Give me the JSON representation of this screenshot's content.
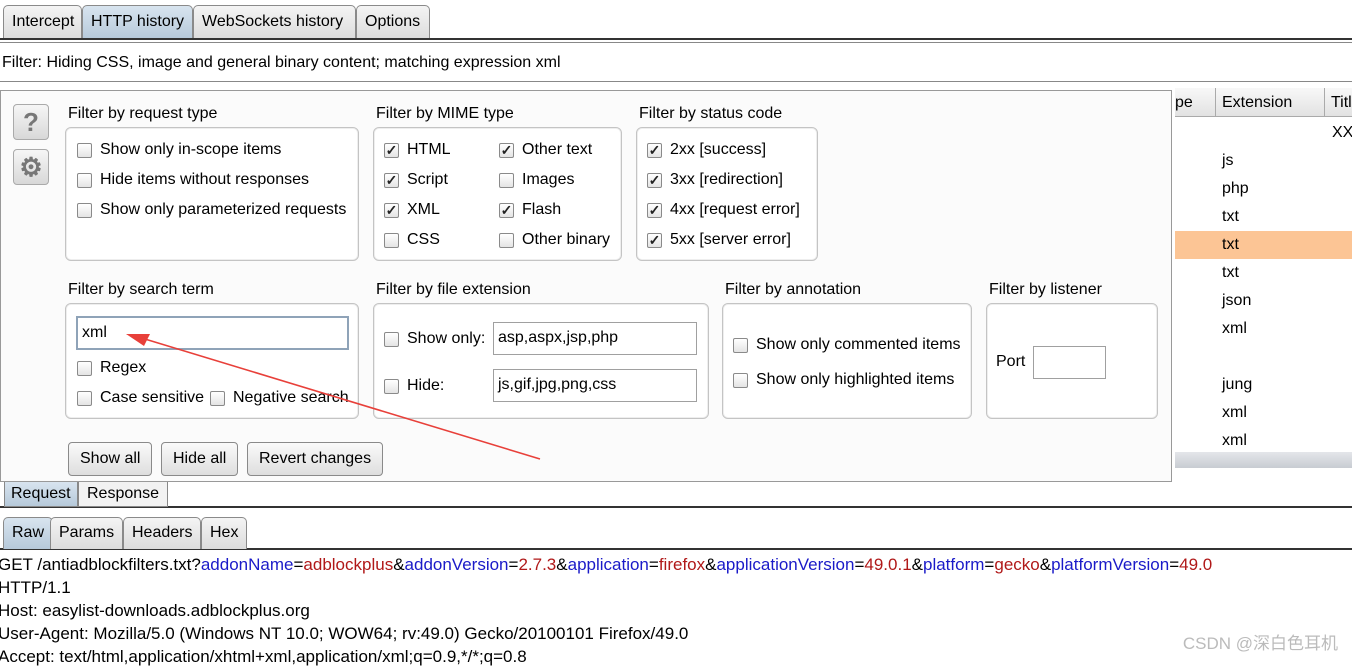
{
  "tabs": [
    {
      "label": "Intercept"
    },
    {
      "label": "HTTP history",
      "selected": true
    },
    {
      "label": "WebSockets history"
    },
    {
      "label": "Options"
    }
  ],
  "filter_bar": "Filter: Hiding CSS, image and general binary content;  matching expression xml",
  "table": {
    "headers": [
      "pe",
      "Extension",
      "Titl"
    ],
    "rows": [
      {
        "ext": "",
        "title": "XX"
      },
      {
        "ext": "js"
      },
      {
        "ext": "php"
      },
      {
        "ext": "txt"
      },
      {
        "ext": "txt",
        "highlighted": true
      },
      {
        "ext": "txt"
      },
      {
        "ext": "json"
      },
      {
        "ext": "xml"
      },
      {
        "ext": ""
      },
      {
        "ext": "jung"
      },
      {
        "ext": "xml"
      },
      {
        "ext": "xml"
      }
    ],
    "highlight_color": "#fcc595"
  },
  "filter": {
    "help_icon": "question-icon",
    "settings_icon": "gear-icon",
    "request_type": {
      "title": "Filter by request type",
      "items": [
        {
          "label": "Show only in-scope items",
          "checked": false
        },
        {
          "label": "Hide items without responses",
          "checked": false
        },
        {
          "label": "Show only parameterized requests",
          "checked": false
        }
      ]
    },
    "mime": {
      "title": "Filter by MIME type",
      "items": [
        {
          "label": "HTML",
          "checked": true
        },
        {
          "label": "Other text",
          "checked": true
        },
        {
          "label": "Script",
          "checked": true
        },
        {
          "label": "Images",
          "checked": false
        },
        {
          "label": "XML",
          "checked": true
        },
        {
          "label": "Flash",
          "checked": true
        },
        {
          "label": "CSS",
          "checked": false
        },
        {
          "label": "Other binary",
          "checked": false
        }
      ]
    },
    "status": {
      "title": "Filter by status code",
      "items": [
        {
          "label": "2xx  [success]",
          "checked": true
        },
        {
          "label": "3xx  [redirection]",
          "checked": true
        },
        {
          "label": "4xx  [request error]",
          "checked": true
        },
        {
          "label": "5xx  [server error]",
          "checked": true
        }
      ]
    },
    "search": {
      "title": "Filter by search term",
      "value": "xml",
      "regex": "Regex",
      "case": "Case sensitive",
      "negative": "Negative search"
    },
    "extension": {
      "title": "Filter by file extension",
      "show_only_label": "Show only:",
      "show_only_value": "asp,aspx,jsp,php",
      "hide_label": "Hide:",
      "hide_value": "js,gif,jpg,png,css"
    },
    "annotation": {
      "title": "Filter by annotation",
      "commented": "Show only commented items",
      "highlighted": "Show only highlighted items"
    },
    "listener": {
      "title": "Filter by listener",
      "port_label": "Port",
      "port_value": ""
    },
    "buttons": {
      "show_all": "Show all",
      "hide_all": "Hide all",
      "revert": "Revert changes"
    }
  },
  "message_tabs": [
    {
      "label": "Request",
      "selected": true
    },
    {
      "label": "Response"
    }
  ],
  "view_tabs": [
    {
      "label": "Raw",
      "selected": true
    },
    {
      "label": "Params"
    },
    {
      "label": "Headers"
    },
    {
      "label": "Hex"
    }
  ],
  "request": {
    "line1": [
      {
        "t": "GET /antiadblockfilters.txt?",
        "c": ""
      },
      {
        "t": "addonName",
        "c": "k"
      },
      {
        "t": "=",
        "c": ""
      },
      {
        "t": "adblockplus",
        "c": "v"
      },
      {
        "t": "&",
        "c": ""
      },
      {
        "t": "addonVersion",
        "c": "k"
      },
      {
        "t": "=",
        "c": ""
      },
      {
        "t": "2.7.3",
        "c": "v"
      },
      {
        "t": "&",
        "c": ""
      },
      {
        "t": "application",
        "c": "k"
      },
      {
        "t": "=",
        "c": ""
      },
      {
        "t": "firefox",
        "c": "v"
      },
      {
        "t": "&",
        "c": ""
      },
      {
        "t": "applicationVersion",
        "c": "k"
      },
      {
        "t": "=",
        "c": ""
      },
      {
        "t": "49.0.1",
        "c": "v"
      },
      {
        "t": "&",
        "c": ""
      },
      {
        "t": "platform",
        "c": "k"
      },
      {
        "t": "=",
        "c": ""
      },
      {
        "t": "gecko",
        "c": "v"
      },
      {
        "t": "&",
        "c": ""
      },
      {
        "t": "platformVersion",
        "c": "k"
      },
      {
        "t": "=",
        "c": ""
      },
      {
        "t": "49.0",
        "c": "v"
      }
    ],
    "lines": [
      "HTTP/1.1",
      "Host: easylist-downloads.adblockplus.org",
      "User-Agent: Mozilla/5.0 (Windows NT 10.0; WOW64; rv:49.0) Gecko/20100101 Firefox/49.0",
      "Accept: text/html,application/xhtml+xml,application/xml;q=0.9,*/*;q=0.8"
    ]
  },
  "watermark": "CSDN @深白色耳机",
  "colors": {
    "arrow": "#e8403a",
    "selected_tab": "#b6c9da"
  }
}
